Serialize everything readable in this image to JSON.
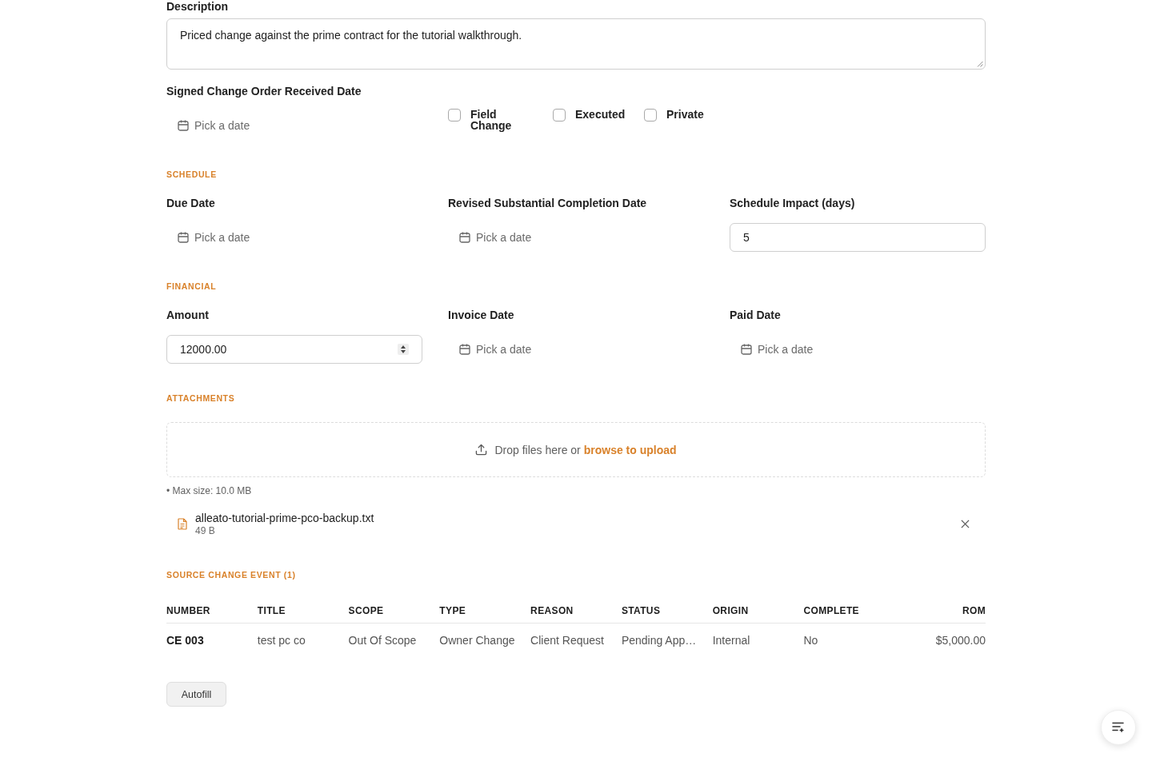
{
  "description": {
    "label": "Description",
    "value": "Priced change against the prime contract for the tutorial walkthrough."
  },
  "signed_received_date": {
    "label": "Signed Change Order Received Date",
    "placeholder": "Pick a date"
  },
  "flags": [
    {
      "label": "Field Change",
      "checked": false
    },
    {
      "label": "Executed",
      "checked": false
    },
    {
      "label": "Private",
      "checked": false
    }
  ],
  "sections": [
    {
      "heading": "SCHEDULE",
      "fields": [
        {
          "kind": "date",
          "label": "Due Date",
          "placeholder": "Pick a date"
        },
        {
          "kind": "date",
          "label": "Revised Substantial Completion Date",
          "placeholder": "Pick a date"
        },
        {
          "kind": "text",
          "label": "Schedule Impact (days)",
          "value": "5"
        }
      ]
    },
    {
      "heading": "FINANCIAL",
      "fields": [
        {
          "kind": "number",
          "label": "Amount",
          "value": "12000.00"
        },
        {
          "kind": "date",
          "label": "Invoice Date",
          "placeholder": "Pick a date"
        },
        {
          "kind": "date",
          "label": "Paid Date",
          "placeholder": "Pick a date"
        }
      ]
    }
  ],
  "attachments": {
    "heading": "ATTACHMENTS",
    "dropzone": {
      "text": "Drop files here or",
      "link": "browse to upload"
    },
    "note": "• Max size: 10.0 MB",
    "files": [
      {
        "name": "alleato-tutorial-prime-pco-backup.txt",
        "size": "49 B"
      }
    ]
  },
  "source_change_event": {
    "heading": "SOURCE CHANGE EVENT (1)",
    "columns": [
      "NUMBER",
      "TITLE",
      "SCOPE",
      "TYPE",
      "REASON",
      "STATUS",
      "ORIGIN",
      "COMPLETE",
      "ROM"
    ],
    "rows": [
      [
        "CE 003",
        "test pc co",
        "Out Of Scope",
        "Owner Change",
        "Client Request",
        "Pending App…",
        "Internal",
        "No",
        "$5,000.00"
      ]
    ]
  },
  "autofill_button": {
    "label": "Autofill"
  }
}
